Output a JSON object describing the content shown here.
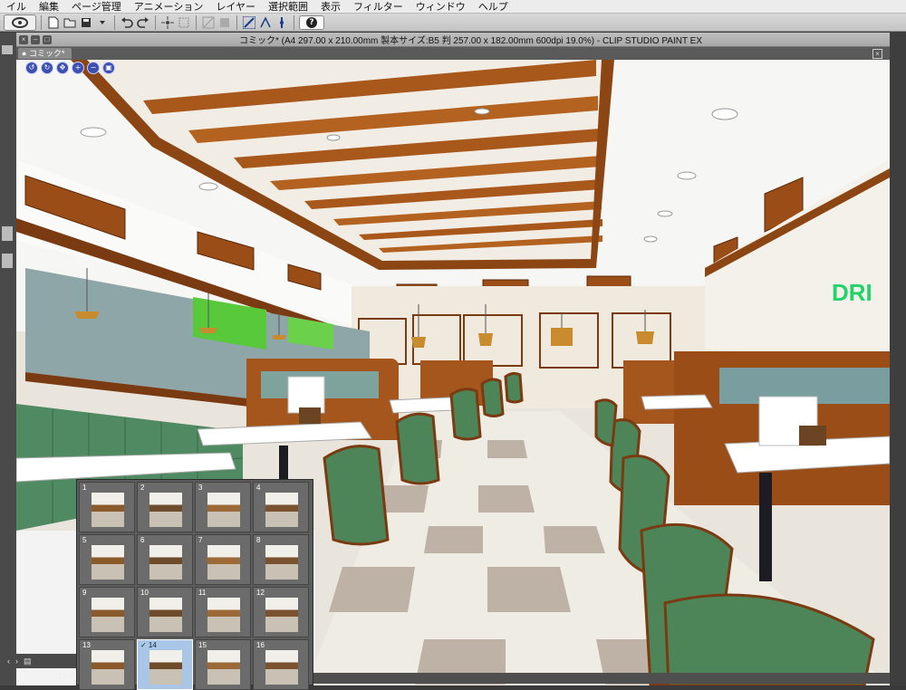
{
  "menu": [
    "イル",
    "編集",
    "ページ管理",
    "アニメーション",
    "レイヤー",
    "選択範囲",
    "表示",
    "フィルター",
    "ウィンドウ",
    "ヘルプ"
  ],
  "window": {
    "title": "コミック* (A4 297.00 x 210.00mm 製本サイズ:B5 判 257.00 x 182.00mm 600dpi 19.0%)  - CLIP STUDIO PAINT EX"
  },
  "document_tab": {
    "label": "コミック*"
  },
  "canvas": {
    "sign_text": "DRI",
    "colors": {
      "ceiling": "#f4f4f2",
      "wood": "#a5561d",
      "booth_green": "#4f8a62",
      "floor_light": "#f2efe6",
      "floor_dark": "#b9ada0"
    }
  },
  "page_panel": {
    "pages": [
      {
        "num": "1",
        "selected": false
      },
      {
        "num": "2",
        "selected": false
      },
      {
        "num": "3",
        "selected": false
      },
      {
        "num": "4",
        "selected": false
      },
      {
        "num": "5",
        "selected": false
      },
      {
        "num": "6",
        "selected": false
      },
      {
        "num": "7",
        "selected": false
      },
      {
        "num": "8",
        "selected": false
      },
      {
        "num": "9",
        "selected": false
      },
      {
        "num": "10",
        "selected": false
      },
      {
        "num": "11",
        "selected": false
      },
      {
        "num": "12",
        "selected": false
      },
      {
        "num": "13",
        "selected": false
      },
      {
        "num": "✓ 14",
        "selected": true
      },
      {
        "num": "15",
        "selected": false
      },
      {
        "num": "16",
        "selected": false
      }
    ],
    "zoom": "19.0"
  },
  "icons": {
    "nav": [
      "rotate-left-icon",
      "rotate-right-icon",
      "move-icon",
      "zoom-in-icon",
      "zoom-out-icon",
      "fit-icon"
    ]
  }
}
